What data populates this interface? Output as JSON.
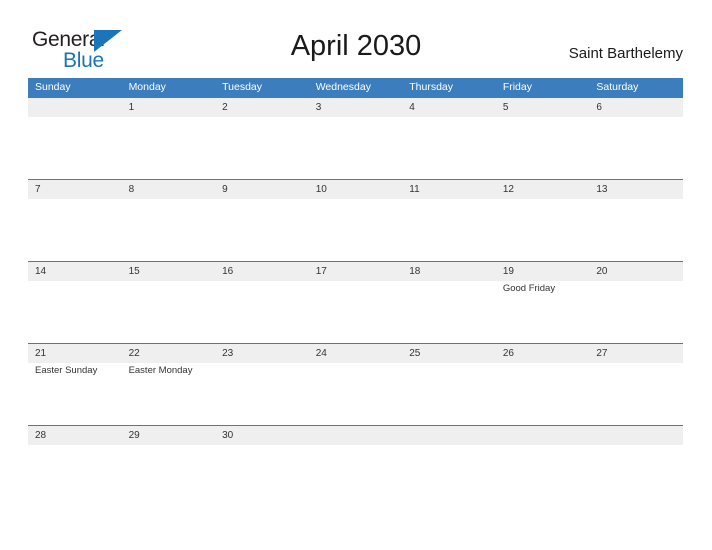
{
  "brand": {
    "name_part1": "General",
    "name_part2": "Blue"
  },
  "header": {
    "title": "April 2030",
    "location": "Saint Barthelemy"
  },
  "calendar": {
    "day_headers": [
      "Sunday",
      "Monday",
      "Tuesday",
      "Wednesday",
      "Thursday",
      "Friday",
      "Saturday"
    ],
    "colors": {
      "header_blue": "#3b7dbd",
      "date_band_gray": "#efefef",
      "brand_blue": "#1b75bb",
      "text": "#333333"
    },
    "weeks": [
      {
        "days": [
          {
            "num": "",
            "events": []
          },
          {
            "num": "1",
            "events": []
          },
          {
            "num": "2",
            "events": []
          },
          {
            "num": "3",
            "events": []
          },
          {
            "num": "4",
            "events": []
          },
          {
            "num": "5",
            "events": []
          },
          {
            "num": "6",
            "events": []
          }
        ]
      },
      {
        "days": [
          {
            "num": "7",
            "events": []
          },
          {
            "num": "8",
            "events": []
          },
          {
            "num": "9",
            "events": []
          },
          {
            "num": "10",
            "events": []
          },
          {
            "num": "11",
            "events": []
          },
          {
            "num": "12",
            "events": []
          },
          {
            "num": "13",
            "events": []
          }
        ]
      },
      {
        "days": [
          {
            "num": "14",
            "events": []
          },
          {
            "num": "15",
            "events": []
          },
          {
            "num": "16",
            "events": []
          },
          {
            "num": "17",
            "events": []
          },
          {
            "num": "18",
            "events": []
          },
          {
            "num": "19",
            "events": [
              "Good Friday"
            ]
          },
          {
            "num": "20",
            "events": []
          }
        ]
      },
      {
        "days": [
          {
            "num": "21",
            "events": [
              "Easter Sunday"
            ]
          },
          {
            "num": "22",
            "events": [
              "Easter Monday"
            ]
          },
          {
            "num": "23",
            "events": []
          },
          {
            "num": "24",
            "events": []
          },
          {
            "num": "25",
            "events": []
          },
          {
            "num": "26",
            "events": []
          },
          {
            "num": "27",
            "events": []
          }
        ]
      },
      {
        "days": [
          {
            "num": "28",
            "events": []
          },
          {
            "num": "29",
            "events": []
          },
          {
            "num": "30",
            "events": []
          },
          {
            "num": "",
            "events": []
          },
          {
            "num": "",
            "events": []
          },
          {
            "num": "",
            "events": []
          },
          {
            "num": "",
            "events": []
          }
        ]
      }
    ]
  }
}
